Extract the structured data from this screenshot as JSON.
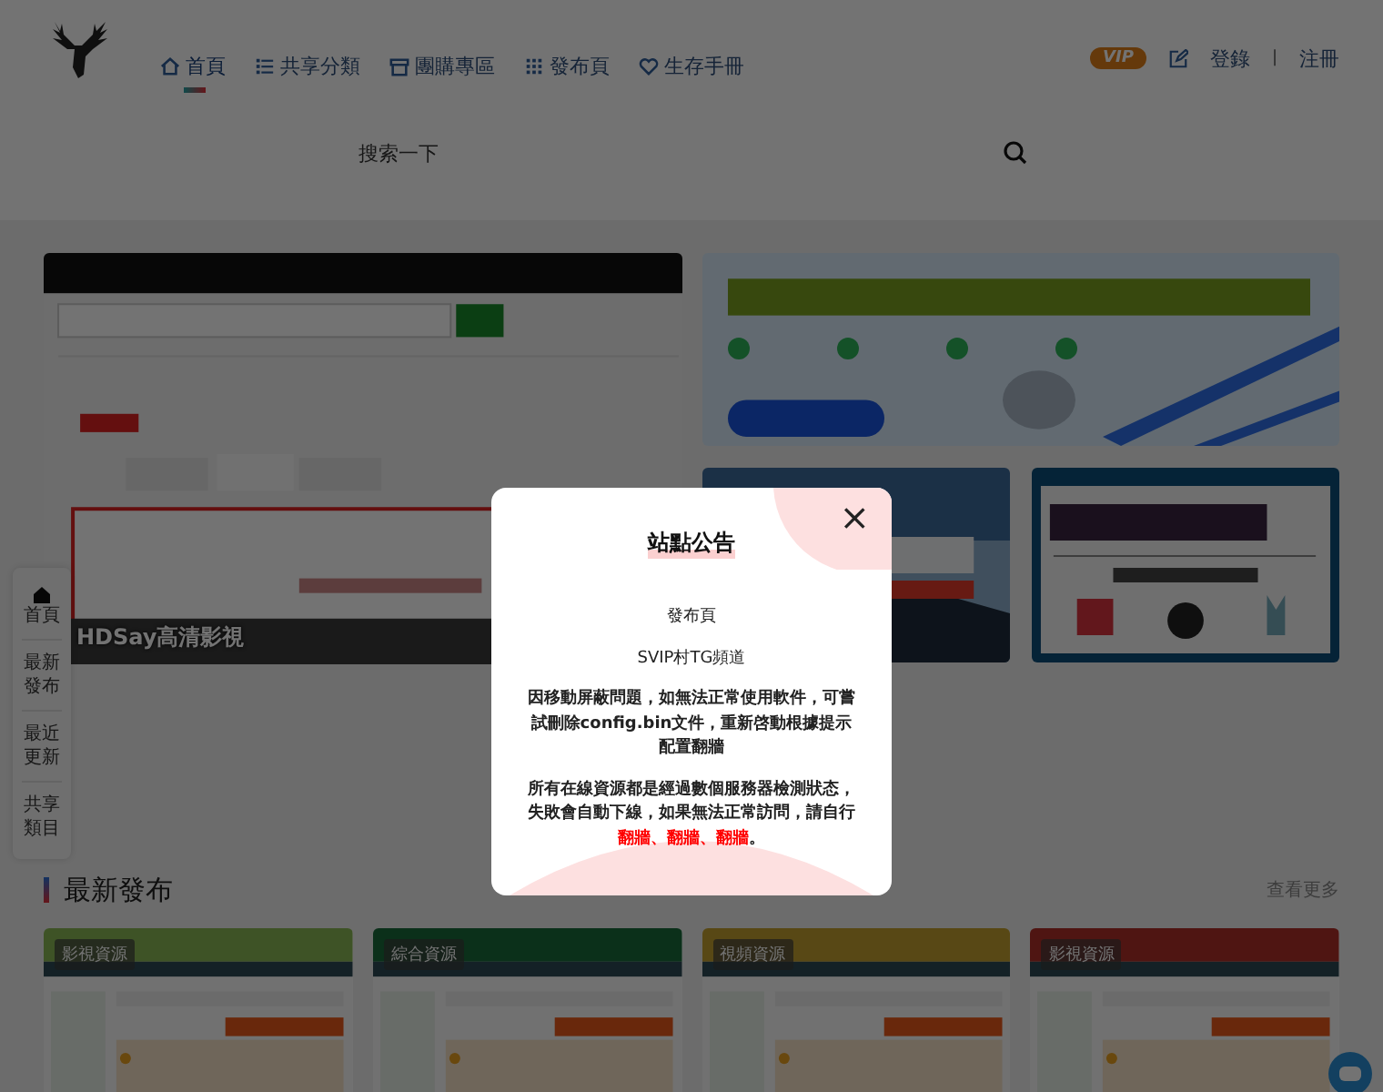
{
  "header": {
    "nav": [
      {
        "label": "首頁",
        "selected": true
      },
      {
        "label": "共享分類",
        "selected": false
      },
      {
        "label": "團購專區",
        "selected": false
      },
      {
        "label": "發布頁",
        "selected": false
      },
      {
        "label": "生存手冊",
        "selected": false
      }
    ],
    "vip": "VIP",
    "login": "登錄",
    "separator": "|",
    "register": "注冊"
  },
  "search": {
    "placeholder": "搜索一下"
  },
  "carousel": {
    "caption": "HDSay高清影視",
    "kind": "picture"
  },
  "side_nav": [
    {
      "label": "首頁",
      "icon": true
    },
    {
      "label": "最新發布",
      "icon": false
    },
    {
      "label": "最近更新",
      "icon": false
    },
    {
      "label": "共享類目",
      "icon": false
    }
  ],
  "latest": {
    "title": "最新發布",
    "more": "查看更多",
    "cards": [
      {
        "badge": "影視資源"
      },
      {
        "badge": "綜合資源"
      },
      {
        "badge": "視頻資源"
      },
      {
        "badge": "影視資源"
      }
    ]
  },
  "notice": {
    "title": "站點公告",
    "close": "×",
    "paragraphs": [
      {
        "bold": false,
        "segments": [
          {
            "text": "發布頁",
            "red": false
          }
        ]
      },
      {
        "bold": false,
        "segments": [
          {
            "text": "SVIP村TG頻道",
            "red": false
          }
        ]
      },
      {
        "bold": true,
        "segments": [
          {
            "text": "因移動屏蔽問題，如無法正常使用軟件，可嘗試刪除config.bin文件，重新啓動根據提示配置翻牆",
            "red": false
          }
        ]
      },
      {
        "bold": true,
        "segments": [
          {
            "text": "所有在線資源都是經過數個服務器檢測狀态，失敗會自動下線，如果無法正常訪問，請自行",
            "red": false
          },
          {
            "text": "翻牆、翻牆、翻牆",
            "red": true
          },
          {
            "text": "。",
            "red": false
          }
        ]
      }
    ]
  }
}
